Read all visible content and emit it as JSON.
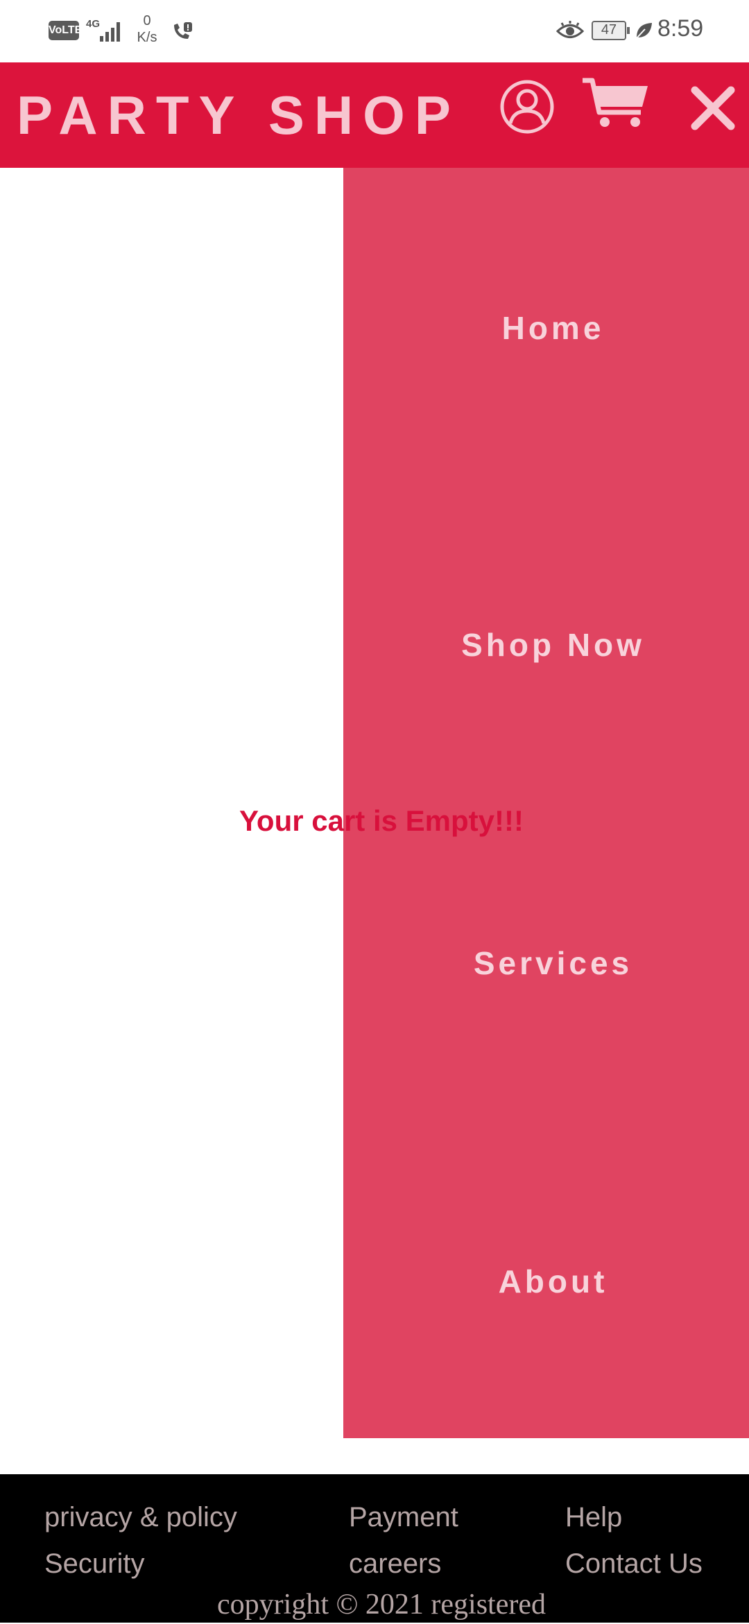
{
  "status_bar": {
    "volte": "VoLTE",
    "network": "4G",
    "speed_value": "0",
    "speed_unit": "K/s",
    "battery": "47",
    "time": "8:59"
  },
  "header": {
    "brand": "PARTY SHOP",
    "background_color": "#dc143c",
    "icons": [
      "user-icon",
      "cart-icon",
      "close-icon"
    ]
  },
  "menu": {
    "background_color": "#e04461",
    "items": [
      {
        "label": "Home"
      },
      {
        "label": "Shop Now"
      },
      {
        "label": "Services"
      },
      {
        "label": "About"
      }
    ]
  },
  "cart": {
    "message": "Your cart is Empty!!!"
  },
  "footer": {
    "links": [
      {
        "label": "privacy & policy"
      },
      {
        "label": "Security"
      },
      {
        "label": "Payment"
      },
      {
        "label": "careers"
      },
      {
        "label": "Help"
      },
      {
        "label": "Contact Us"
      }
    ],
    "copyright": "copyright © 2021 registered"
  }
}
